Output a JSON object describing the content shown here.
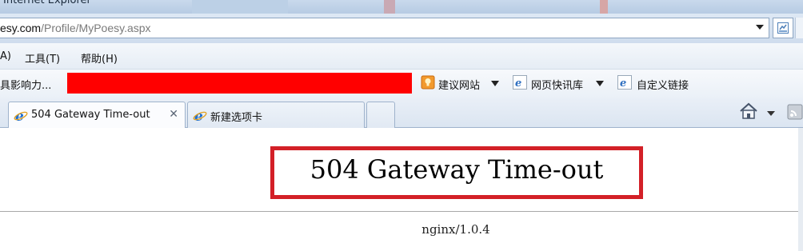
{
  "window": {
    "title": "Internet Explorer"
  },
  "address_bar": {
    "host": "esy.com",
    "path": "/Profile/MyPoesy.aspx"
  },
  "menu": {
    "items": [
      {
        "label": "A)"
      },
      {
        "label": "工具(T)"
      },
      {
        "label": "帮助(H)"
      }
    ]
  },
  "favorites": {
    "cut_text": "具影响力...",
    "items": [
      {
        "label": "建议网站",
        "icon": "suggested-sites-icon",
        "has_dropdown": true
      },
      {
        "label": "网页快讯库",
        "icon": "ie-icon",
        "has_dropdown": true
      },
      {
        "label": "自定义链接",
        "icon": "ie-icon",
        "has_dropdown": false
      }
    ]
  },
  "tabs": [
    {
      "label": "504 Gateway Time-out",
      "active": true
    },
    {
      "label": "新建选项卡",
      "active": false
    }
  ],
  "page": {
    "error_title": "504 Gateway Time-out",
    "footer": "nginx/1.0.4"
  },
  "colors": {
    "annotation_red": "#d32027",
    "redaction_red": "#ff0000"
  }
}
